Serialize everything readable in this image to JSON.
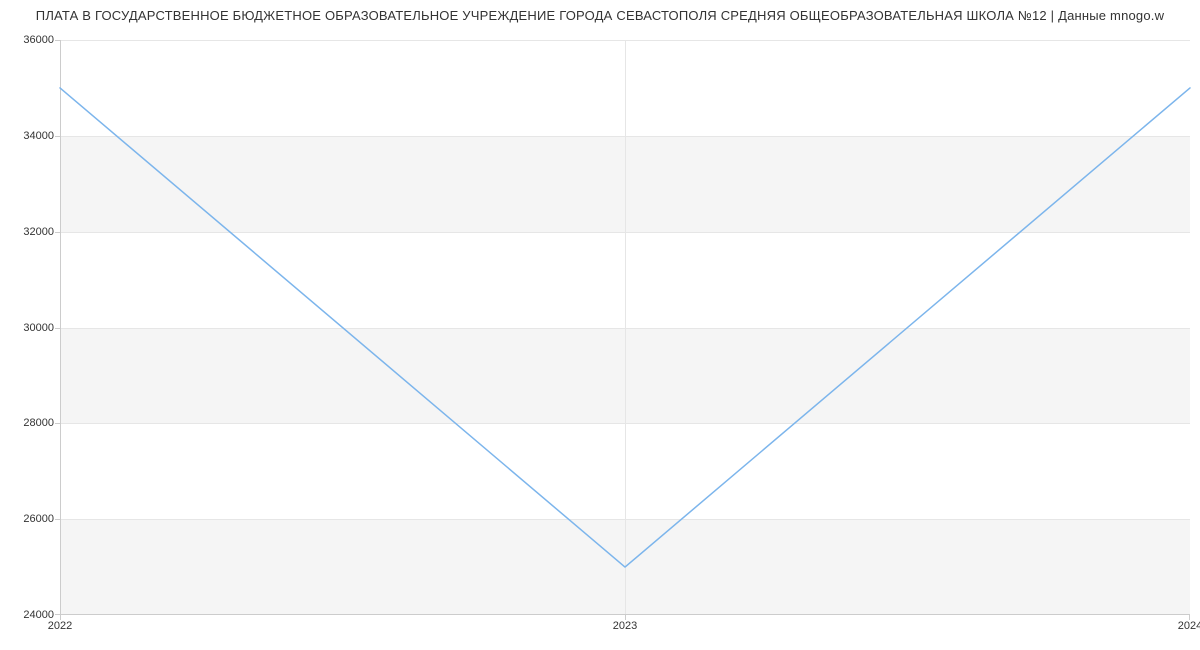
{
  "chart_data": {
    "type": "line",
    "title": "ПЛАТА В ГОСУДАРСТВЕННОЕ БЮДЖЕТНОЕ ОБРАЗОВАТЕЛЬНОЕ УЧРЕЖДЕНИЕ ГОРОДА СЕВАСТОПОЛЯ СРЕДНЯЯ ОБЩЕОБРАЗОВАТЕЛЬНАЯ ШКОЛА №12 | Данные mnogo.w",
    "categories": [
      "2022",
      "2023",
      "2024"
    ],
    "values": [
      35000,
      25000,
      35000
    ],
    "xlabel": "",
    "ylabel": "",
    "ylim": [
      24000,
      36000
    ],
    "y_ticks": [
      24000,
      26000,
      28000,
      30000,
      32000,
      34000,
      36000
    ],
    "line_color": "#7cb5ec",
    "band_color": "#f5f5f5"
  }
}
